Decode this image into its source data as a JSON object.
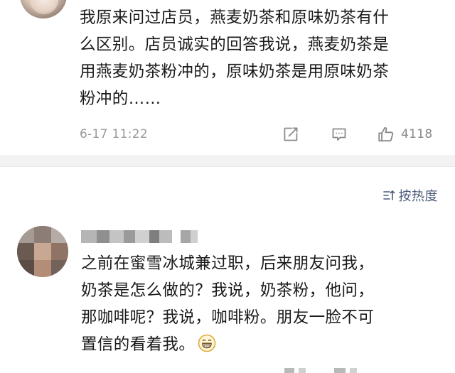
{
  "comments": [
    {
      "verified": true,
      "text_lines": [
        "我原来问过店员，燕麦奶茶和原味奶茶有什",
        "么区别。店员诚实的回答我说，燕麦奶茶是",
        "用燕麦奶茶粉冲的，原味奶茶是用原味奶茶",
        "粉冲的……"
      ],
      "timestamp": "6-17 11:22",
      "like_count": "4118",
      "icons": [
        "share-icon",
        "comment-icon",
        "like-icon",
        "verified-badge-icon"
      ]
    },
    {
      "username_blurred": true,
      "text_lines": [
        "之前在蜜雪冰城兼过职，后来朋友问我，",
        "奶茶是怎么做的？我说，奶茶粉，他问，",
        "那咖啡呢？我说，咖啡粉。朋友一脸不可",
        "置信的看着我。"
      ],
      "emoji": "grinning-face-emoji"
    }
  ],
  "sort_toggle": {
    "label": "按热度",
    "icon": "sort-icon"
  },
  "colors": {
    "text": "#1a1a1a",
    "meta": "#9b9b9b",
    "sort_label": "#4a5a7a",
    "divider": "#f2f2f2",
    "verified_badge": "#f5a623"
  }
}
